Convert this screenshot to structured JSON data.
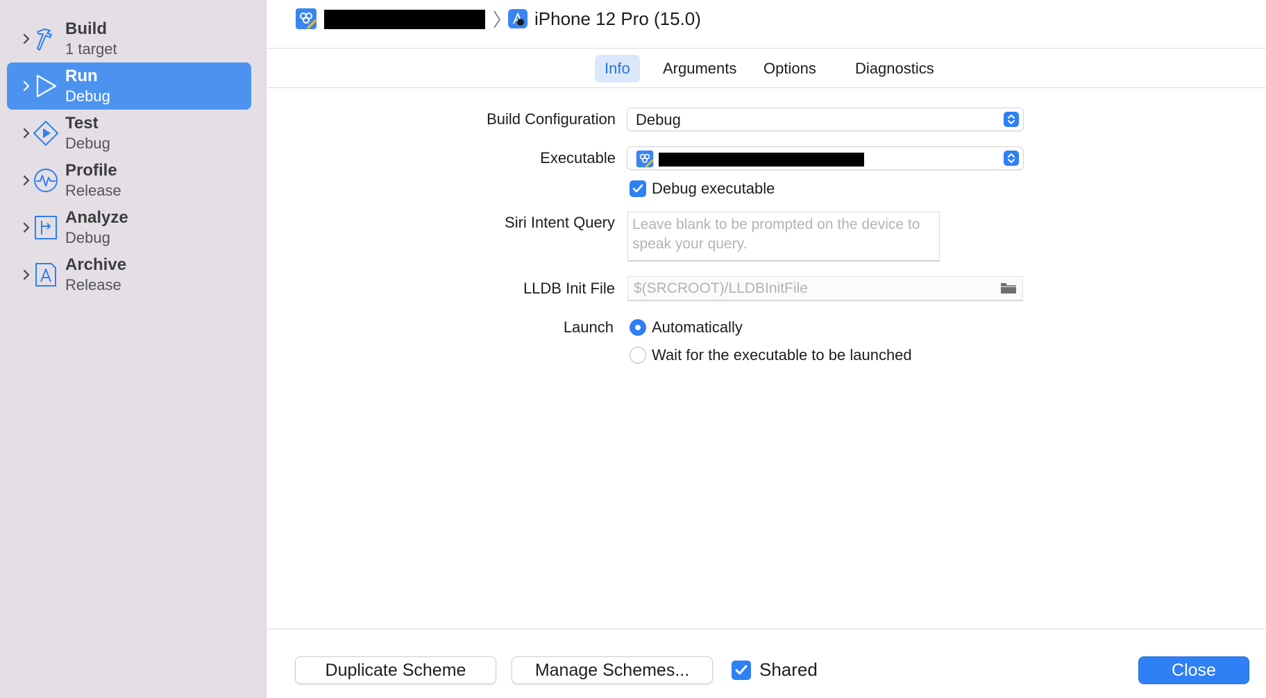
{
  "sidebar": {
    "items": [
      {
        "title": "Build",
        "subtitle": "1 target",
        "icon": "hammer-icon",
        "selected": false
      },
      {
        "title": "Run",
        "subtitle": "Debug",
        "icon": "play-icon",
        "selected": true
      },
      {
        "title": "Test",
        "subtitle": "Debug",
        "icon": "test-diamond-icon",
        "selected": false
      },
      {
        "title": "Profile",
        "subtitle": "Release",
        "icon": "waveform-icon",
        "selected": false
      },
      {
        "title": "Analyze",
        "subtitle": "Debug",
        "icon": "analyze-icon",
        "selected": false
      },
      {
        "title": "Archive",
        "subtitle": "Release",
        "icon": "archive-icon",
        "selected": false
      }
    ]
  },
  "breadcrumb": {
    "device": "iPhone 12 Pro (15.0)"
  },
  "tabs": [
    {
      "label": "Info",
      "active": true
    },
    {
      "label": "Arguments",
      "active": false
    },
    {
      "label": "Options",
      "active": false
    },
    {
      "label": "Diagnostics",
      "active": false
    }
  ],
  "form": {
    "build_configuration": {
      "label": "Build Configuration",
      "value": "Debug"
    },
    "executable": {
      "label": "Executable"
    },
    "debug_executable": {
      "label": "Debug executable",
      "checked": true
    },
    "siri_intent_query": {
      "label": "Siri Intent Query",
      "placeholder": "Leave blank to be prompted on the device to speak your query."
    },
    "lldb_init_file": {
      "label": "LLDB Init File",
      "placeholder": "$(SRCROOT)/LLDBInitFile"
    },
    "launch": {
      "label": "Launch",
      "options": [
        {
          "label": "Automatically",
          "selected": true
        },
        {
          "label": "Wait for the executable to be launched",
          "selected": false
        }
      ]
    }
  },
  "footer": {
    "duplicate_label": "Duplicate Scheme",
    "manage_label": "Manage Schemes...",
    "shared_label": "Shared",
    "shared_checked": true,
    "close_label": "Close"
  },
  "colors": {
    "accent": "#2f7ff5",
    "sidebar_bg": "#e4dfe5",
    "selection": "#4c93f0"
  }
}
